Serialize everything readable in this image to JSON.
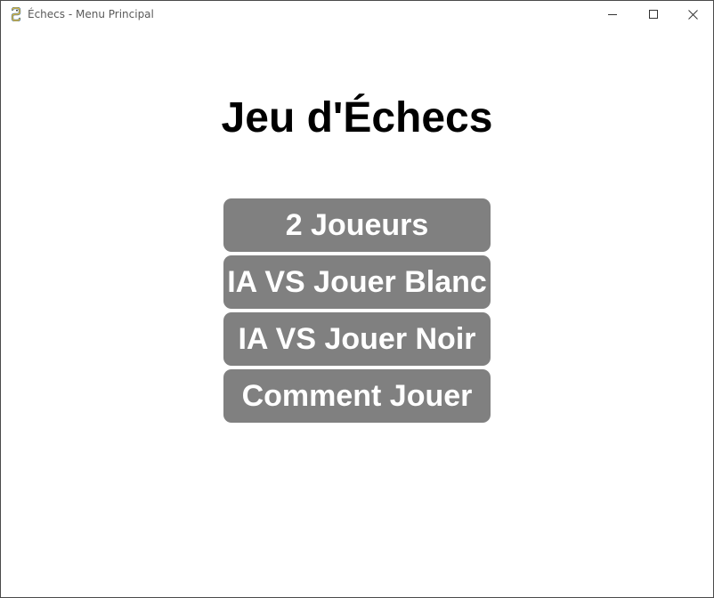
{
  "window": {
    "title": "Échecs - Menu Principal",
    "app_icon": "pygame-snake-icon",
    "controls": {
      "minimize_icon": "minimize-icon",
      "maximize_icon": "maximize-icon",
      "close_icon": "close-icon"
    }
  },
  "main": {
    "heading": "Jeu d'Échecs",
    "buttons": [
      {
        "label": "2 Joueurs"
      },
      {
        "label": "IA VS Jouer Blanc"
      },
      {
        "label": "IA VS Jouer Noir"
      },
      {
        "label": "Comment Jouer"
      }
    ]
  },
  "colors": {
    "button_bg": "#808080",
    "button_text": "#ffffff",
    "heading_text": "#000000",
    "background": "#ffffff"
  }
}
